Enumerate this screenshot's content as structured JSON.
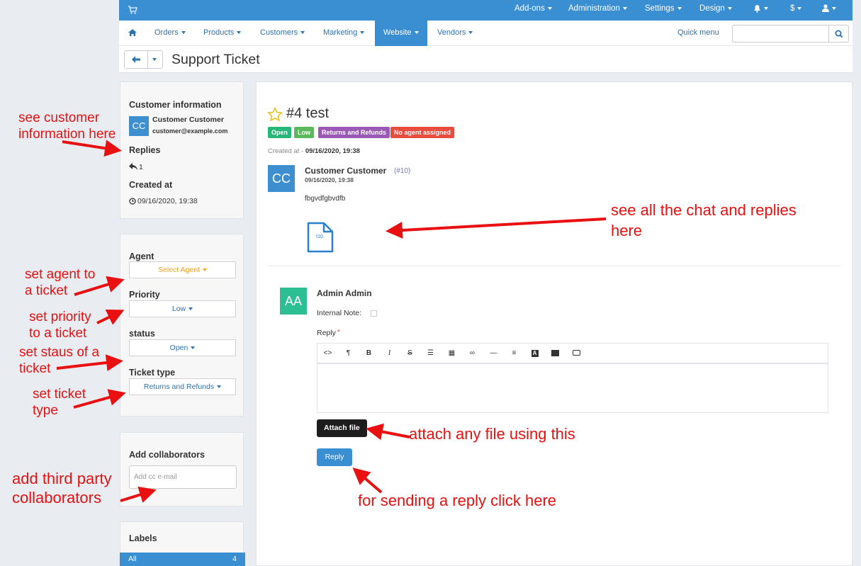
{
  "topbar": {
    "addons": "Add-ons",
    "administration": "Administration",
    "settings": "Settings",
    "design": "Design",
    "currency": "$"
  },
  "navbar": {
    "orders": "Orders",
    "products": "Products",
    "customers": "Customers",
    "marketing": "Marketing",
    "website": "Website",
    "vendors": "Vendors",
    "quick_menu": "Quick menu",
    "search_value": ""
  },
  "page": {
    "title": "Support Ticket"
  },
  "customer_panel": {
    "title": "Customer information",
    "avatar_initials": "CC",
    "name": "Customer Customer",
    "email": "customer@example.com",
    "replies_title": "Replies",
    "replies_count": "1",
    "created_title": "Created at",
    "created_value": "09/16/2020, 19:38"
  },
  "settings_panel": {
    "agent_label": "Agent",
    "agent_value": "Select Agent",
    "priority_label": "Priority",
    "priority_value": "Low",
    "status_label": "status",
    "status_value": "Open",
    "type_label": "Ticket type",
    "type_value": "Returns and Refunds"
  },
  "collab_panel": {
    "title": "Add collaborators",
    "placeholder": "Add cc e-mail"
  },
  "labels_panel": {
    "title": "Labels",
    "all_label": "All",
    "all_count": "4"
  },
  "ticket": {
    "title": "#4 test",
    "badges": [
      {
        "text": "Open",
        "color": "#28b779"
      },
      {
        "text": "Low",
        "color": "#5cb85c"
      },
      {
        "text": "Returns and Refunds",
        "color": "#9b59b6"
      },
      {
        "text": "No agent assigned",
        "color": "#e74c3c"
      }
    ],
    "created_prefix": "Created at - ",
    "created_value": "09/16/2020, 19:38"
  },
  "message": {
    "avatar_initials": "CC",
    "author": "Customer Customer",
    "author_id": "(#10)",
    "time": "09/16/2020, 19:38",
    "body": "fbgvdfgbvdfb",
    "attachment_label": "t10."
  },
  "reply": {
    "avatar_initials": "AA",
    "author": "Admin Admin",
    "internal_note_label": "Internal Note:",
    "reply_label": "Reply",
    "required_mark": "*",
    "attach_label": "Attach file",
    "reply_button": "Reply",
    "toolbar": [
      "code-icon",
      "paragraph-icon",
      "bold-icon",
      "italic-icon",
      "strike-icon",
      "bullet-list-icon",
      "table-icon",
      "link-icon",
      "horizontal-rule-icon",
      "align-icon",
      "text-color-icon",
      "image-icon",
      "video-icon"
    ]
  },
  "colors": {
    "primary": "#3a8fd3",
    "annotation": "#e81010"
  },
  "annotations": {
    "customer_info": "see customer\ninformation here",
    "agent": "set agent to\na ticket",
    "priority": "set priority\nto a ticket",
    "status": "set staus of a\nticket",
    "ticket_type": "set ticket\ntype",
    "collaborators": "add third party\ncollaborators",
    "chat": "see all the chat and replies\nhere",
    "attach": "attach any file using this",
    "reply": "for sending a reply click here"
  }
}
